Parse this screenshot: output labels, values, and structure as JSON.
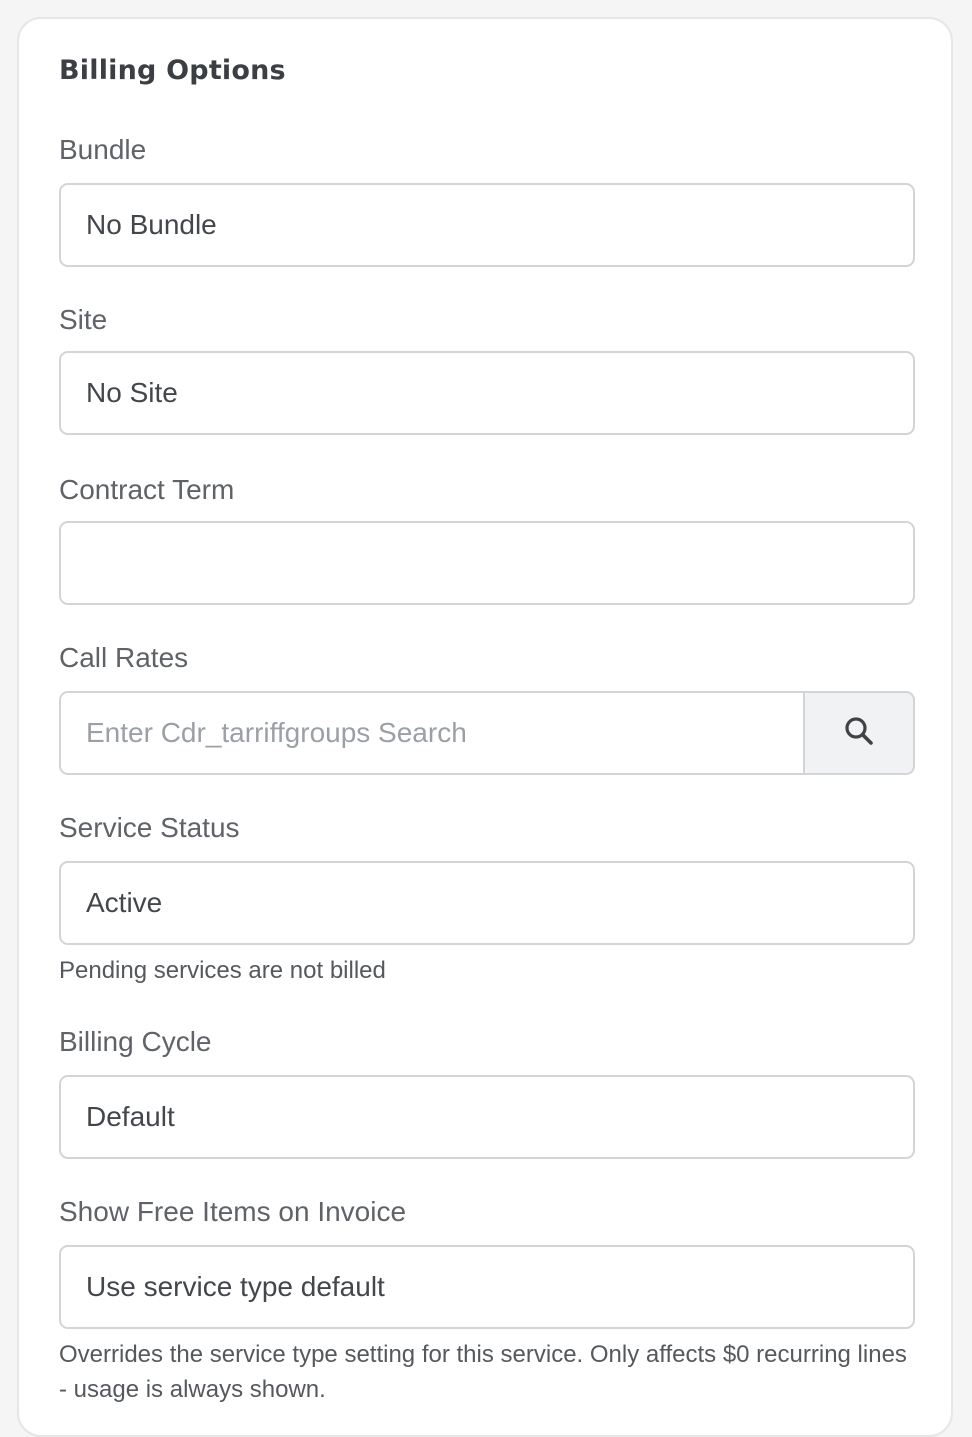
{
  "section": {
    "title": "Billing Options"
  },
  "fields": {
    "bundle": {
      "label": "Bundle",
      "value": "No Bundle"
    },
    "site": {
      "label": "Site",
      "value": "No Site"
    },
    "contract_term": {
      "label": "Contract Term",
      "value": ""
    },
    "call_rates": {
      "label": "Call Rates",
      "placeholder": "Enter Cdr_tarriffgroups Search",
      "search_icon": "search-icon"
    },
    "service_status": {
      "label": "Service Status",
      "value": "Active",
      "help": "Pending services are not billed"
    },
    "billing_cycle": {
      "label": "Billing Cycle",
      "value": "Default"
    },
    "show_free_items": {
      "label": "Show Free Items on Invoice",
      "value": "Use service type default",
      "help": "Overrides the service type setting for this service. Only affects $0 recurring lines - usage is always shown."
    }
  }
}
